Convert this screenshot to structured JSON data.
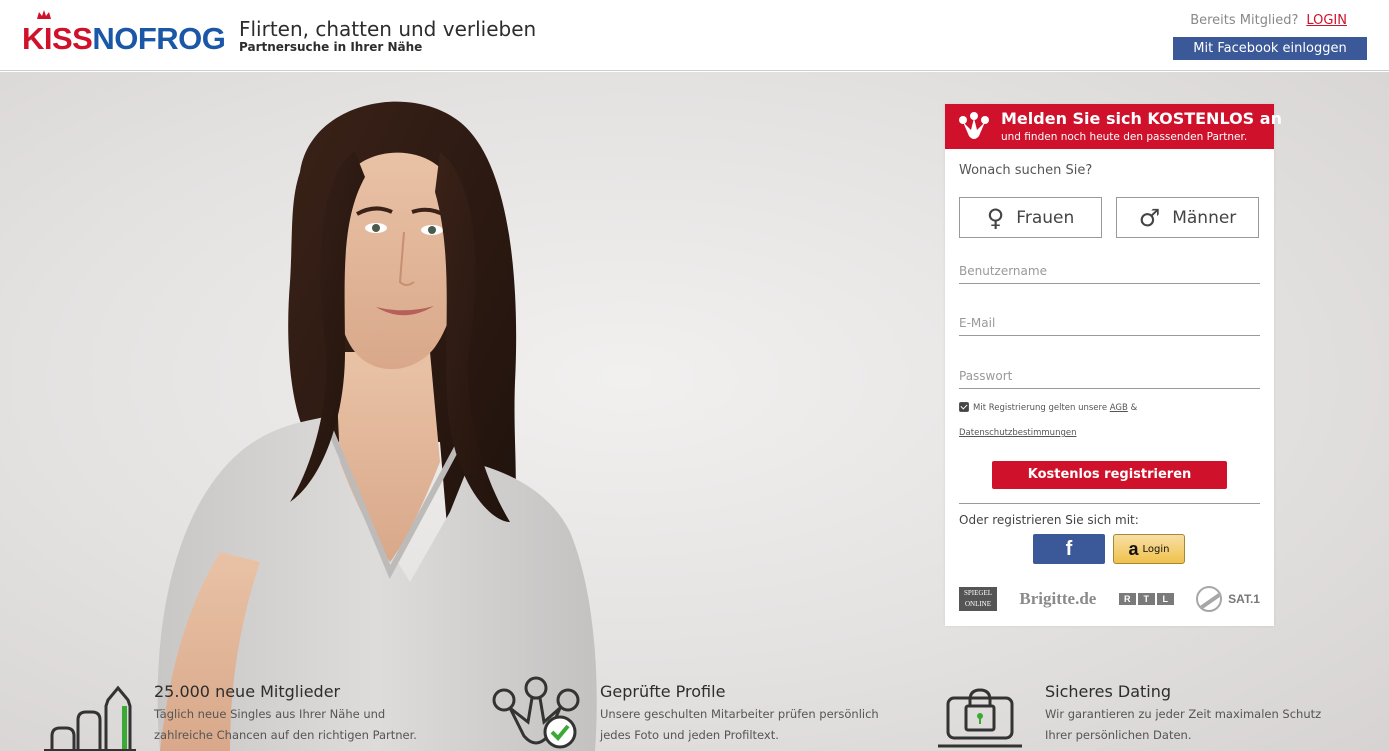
{
  "header": {
    "logo": {
      "part1": "KISS",
      "part2": "NOFROG"
    },
    "slogan_title": "Flirten, chatten und verlieben",
    "slogan_sub": "Partnersuche in Ihrer Nähe",
    "member_text": "Bereits Mitglied?",
    "login_label": "LOGIN",
    "facebook_login_label": "Mit Facebook einloggen"
  },
  "registration": {
    "title": "Melden Sie sich KOSTENLOS an",
    "subtitle": "und finden noch heute den passenden Partner.",
    "search_question": "Wonach suchen Sie?",
    "gender_women": {
      "symbol": "♀",
      "label": "Frauen"
    },
    "gender_men": {
      "symbol": "♂",
      "label": "Männer"
    },
    "username_placeholder": "Benutzername",
    "email_placeholder": "E-Mail",
    "password_placeholder": "Passwort",
    "terms_prefix": "Mit Registrierung gelten unsere",
    "terms_agb": "AGB",
    "terms_amp": "&",
    "terms_privacy": "Datenschutzbestimmungen",
    "terms_checked": true,
    "register_button": "Kostenlos registrieren",
    "or_register_with": "Oder registrieren Sie sich mit:",
    "facebook_button": "f",
    "amazon_button": {
      "mark": "a",
      "label": "Login"
    },
    "press": {
      "spiegel_line1": "SPIEGEL",
      "spiegel_line2": "ONLINE",
      "brigitte": "Brigitte.de",
      "rtl": [
        "R",
        "T",
        "L"
      ],
      "sat1": "SAT.1"
    }
  },
  "features": [
    {
      "icon": "bar-chart-growth-icon",
      "title": "25.000 neue Mitglieder",
      "line1": "Täglich neue Singles aus Ihrer Nähe und",
      "line2": "zahlreiche Chancen auf den richtigen Partner."
    },
    {
      "icon": "verified-frog-icon",
      "title": "Geprüfte Profile",
      "line1": "Unsere geschulten Mitarbeiter prüfen persönlich",
      "line2": "jedes Foto und jeden Profiltext."
    },
    {
      "icon": "secure-laptop-lock-icon",
      "title": "Sicheres Dating",
      "line1": "Wir garantieren zu jeder Zeit maximalen Schutz",
      "line2": "Ihrer persönlichen Daten."
    }
  ],
  "colors": {
    "brand_red": "#d0112b",
    "brand_blue": "#1a57a6",
    "facebook": "#3b5998",
    "check_green": "#3aa935"
  }
}
